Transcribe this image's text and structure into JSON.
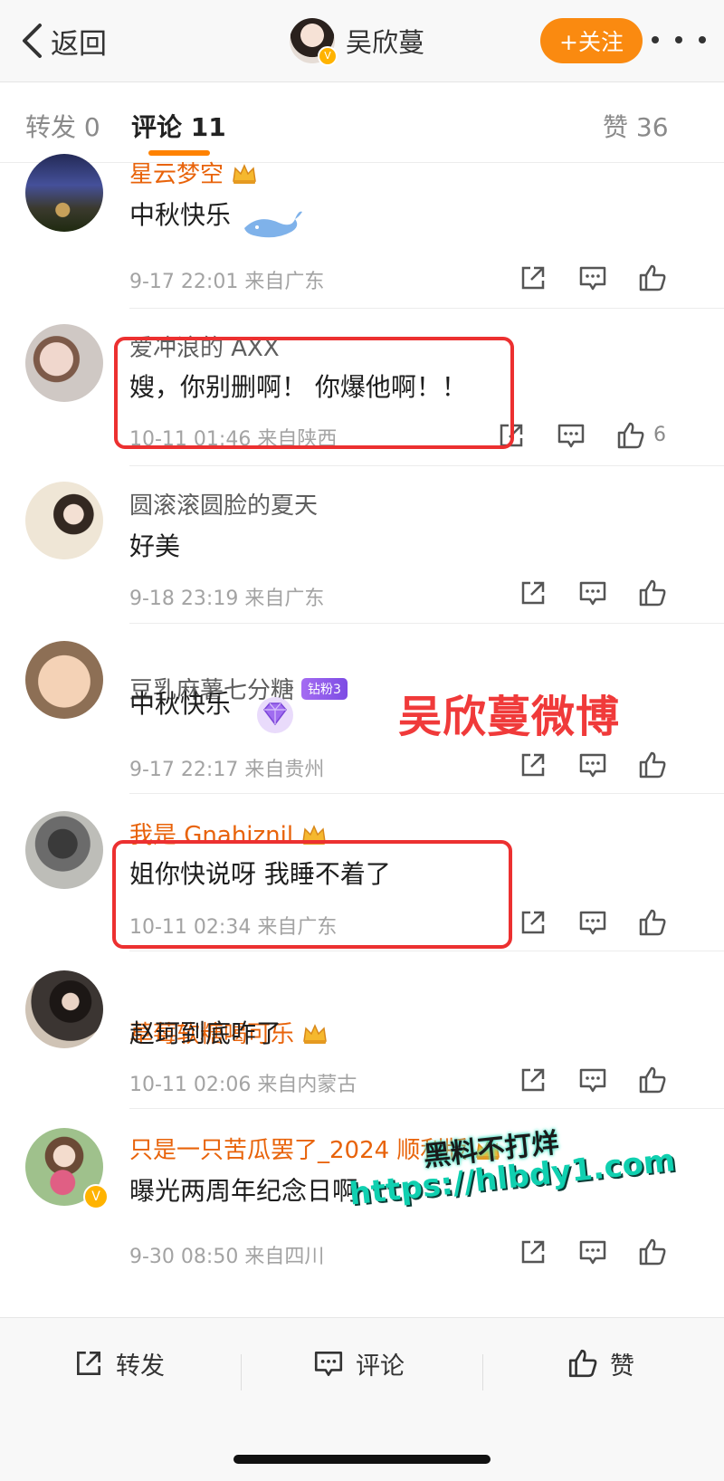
{
  "header": {
    "back_label": "返回",
    "user_name": "吴欣蔓",
    "follow_label": "+关注"
  },
  "tabs": [
    {
      "label": "转发 0"
    },
    {
      "label": "评论 11"
    },
    {
      "label": "赞 36"
    }
  ],
  "comments": [
    {
      "name": "星云梦空",
      "text": "中秋快乐",
      "time": "9-17 22:01 来自广东",
      "likes": ""
    },
    {
      "name": "爱冲浪的 AXX",
      "text": "嫂，你别删啊！ 你爆他啊！！",
      "time": "10-11 01:46 来自陕西",
      "likes": "6"
    },
    {
      "name": "圆滚滚圆脸的夏天",
      "text": "好美",
      "time": "9-18 23:19 来自广东",
      "likes": ""
    },
    {
      "name": "豆乳麻薯七分糖",
      "badge": "钻粉3",
      "text": "中秋快乐",
      "time": "9-17 22:17 来自贵州",
      "likes": ""
    },
    {
      "name": "我是 Gnahiznil",
      "text": "姐你快说呀 我睡不着了",
      "time": "10-11 02:34 来自广东",
      "likes": ""
    },
    {
      "name": "草莓软糖喝可乐",
      "text": "赵珂到底咋了",
      "time": "10-11 02:06 来自内蒙古",
      "likes": ""
    },
    {
      "name": "只是一只苦瓜罢了_2024 顺利版",
      "text": "曝光两周年纪念日啊",
      "time": "9-30 08:50 来自四川",
      "likes": ""
    }
  ],
  "overlay": {
    "title": "吴欣蔓微博",
    "watermark_line1": "黑料不打烊",
    "watermark_line2": "https://hlbdy1.com"
  },
  "bottom": {
    "repost_label": "转发",
    "comment_label": "评论",
    "like_label": "赞"
  },
  "colors": {
    "accent": "#ff8200",
    "follow_button": "#fa8a10",
    "vip_name": "#e8630a",
    "highlight_box": "#ec3030"
  },
  "icons": [
    "chevron-left-icon",
    "more-icon",
    "share-icon",
    "comment-icon",
    "like-icon",
    "crown-icon",
    "verified-icon",
    "diamond-icon",
    "whale-icon"
  ]
}
